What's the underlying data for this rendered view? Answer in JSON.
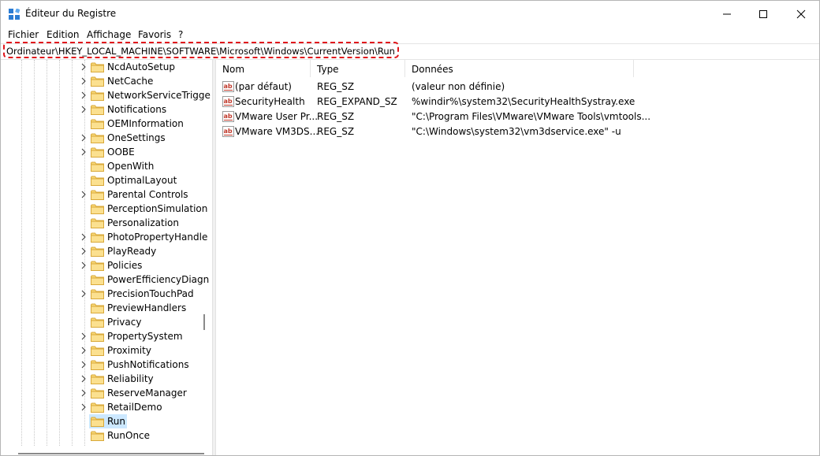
{
  "window": {
    "title": "Éditeur du Registre",
    "controls": {
      "minimize": "minimize-icon",
      "maximize": "maximize-icon",
      "close": "close-icon"
    }
  },
  "menu": [
    "Fichier",
    "Edition",
    "Affichage",
    "Favoris",
    "?"
  ],
  "address": "Ordinateur\\HKEY_LOCAL_MACHINE\\SOFTWARE\\Microsoft\\Windows\\CurrentVersion\\Run",
  "tree": {
    "items": [
      {
        "label": "NcdAutoSetup",
        "expandable": true
      },
      {
        "label": "NetCache",
        "expandable": true
      },
      {
        "label": "NetworkServiceTrigge",
        "expandable": true
      },
      {
        "label": "Notifications",
        "expandable": true
      },
      {
        "label": "OEMInformation",
        "expandable": false
      },
      {
        "label": "OneSettings",
        "expandable": true
      },
      {
        "label": "OOBE",
        "expandable": true
      },
      {
        "label": "OpenWith",
        "expandable": false
      },
      {
        "label": "OptimalLayout",
        "expandable": false
      },
      {
        "label": "Parental Controls",
        "expandable": true
      },
      {
        "label": "PerceptionSimulation",
        "expandable": false
      },
      {
        "label": "Personalization",
        "expandable": false
      },
      {
        "label": "PhotoPropertyHandle",
        "expandable": true
      },
      {
        "label": "PlayReady",
        "expandable": true
      },
      {
        "label": "Policies",
        "expandable": true
      },
      {
        "label": "PowerEfficiencyDiagn",
        "expandable": false
      },
      {
        "label": "PrecisionTouchPad",
        "expandable": true
      },
      {
        "label": "PreviewHandlers",
        "expandable": false
      },
      {
        "label": "Privacy",
        "expandable": false
      },
      {
        "label": "PropertySystem",
        "expandable": true
      },
      {
        "label": "Proximity",
        "expandable": true
      },
      {
        "label": "PushNotifications",
        "expandable": true
      },
      {
        "label": "Reliability",
        "expandable": true
      },
      {
        "label": "ReserveManager",
        "expandable": true
      },
      {
        "label": "RetailDemo",
        "expandable": true
      },
      {
        "label": "Run",
        "expandable": false,
        "selected": true
      },
      {
        "label": "RunOnce",
        "expandable": false
      }
    ]
  },
  "list": {
    "columns": [
      "Nom",
      "Type",
      "Données"
    ],
    "rows": [
      {
        "name": "(par défaut)",
        "type": "REG_SZ",
        "data": "(valeur non définie)"
      },
      {
        "name": "SecurityHealth",
        "type": "REG_EXPAND_SZ",
        "data": "%windir%\\system32\\SecurityHealthSystray.exe"
      },
      {
        "name": "VMware User Pr...",
        "type": "REG_SZ",
        "data": "\"C:\\Program Files\\VMware\\VMware Tools\\vmtools..."
      },
      {
        "name": "VMware VM3DS...",
        "type": "REG_SZ",
        "data": "\"C:\\Windows\\system32\\vm3dservice.exe\" -u"
      }
    ]
  },
  "colors": {
    "highlight_border": "#e0161b",
    "selection": "#cce8ff",
    "folder": "#f8d775"
  }
}
